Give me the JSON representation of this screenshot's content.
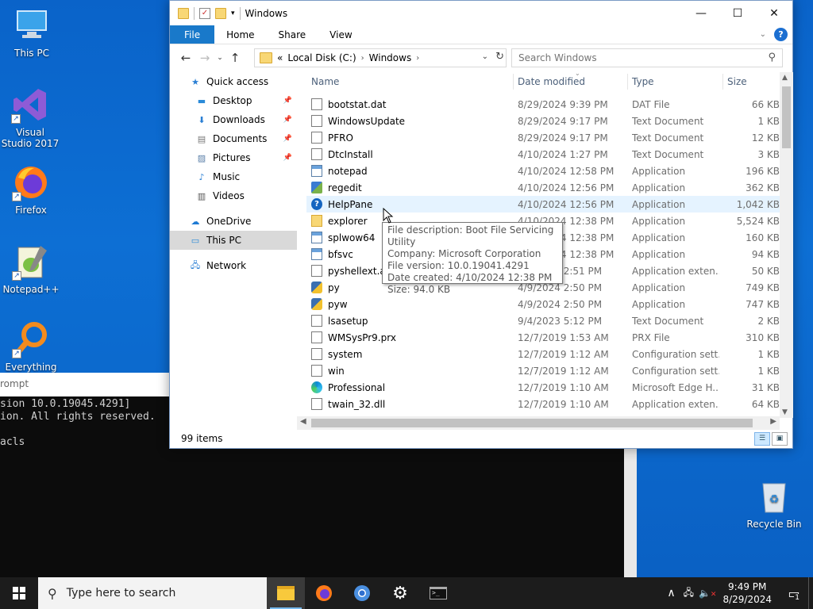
{
  "desktop": {
    "icons": [
      {
        "label": "This PC",
        "name": "this-pc-icon"
      },
      {
        "label": "Visual Studio 2017",
        "name": "visual-studio-icon"
      },
      {
        "label": "Firefox",
        "name": "firefox-icon"
      },
      {
        "label": "Notepad++",
        "name": "notepad-plus-plus-icon"
      },
      {
        "label": "Everything",
        "name": "everything-icon"
      },
      {
        "label": "Recycle Bin",
        "name": "recycle-bin-icon"
      }
    ]
  },
  "console": {
    "title_fragment": "rompt",
    "lines": [
      "sion 10.0.19045.4291]",
      "ion. All rights reserved.",
      "",
      "acls"
    ]
  },
  "explorer": {
    "title": "Windows",
    "caption": {
      "minimize": "—",
      "maximize": "☐",
      "close": "✕"
    },
    "ribbon_tabs": [
      "File",
      "Home",
      "Share",
      "View"
    ],
    "address": {
      "prefix": "«",
      "crumbs": [
        "Local Disk (C:)",
        "Windows"
      ]
    },
    "search_placeholder": "Search Windows",
    "nav": [
      {
        "label": "Quick access",
        "icon": "star-icon",
        "pinned": false,
        "selected": false,
        "indent": 1
      },
      {
        "label": "Desktop",
        "icon": "desktop-icon",
        "pinned": true,
        "selected": false,
        "indent": 2
      },
      {
        "label": "Downloads",
        "icon": "download-icon",
        "pinned": true,
        "selected": false,
        "indent": 2
      },
      {
        "label": "Documents",
        "icon": "documents-icon",
        "pinned": true,
        "selected": false,
        "indent": 2
      },
      {
        "label": "Pictures",
        "icon": "pictures-icon",
        "pinned": true,
        "selected": false,
        "indent": 2
      },
      {
        "label": "Music",
        "icon": "music-icon",
        "pinned": false,
        "selected": false,
        "indent": 2
      },
      {
        "label": "Videos",
        "icon": "videos-icon",
        "pinned": false,
        "selected": false,
        "indent": 2
      },
      {
        "label": "OneDrive",
        "icon": "onedrive-icon",
        "pinned": false,
        "selected": false,
        "indent": 1
      },
      {
        "label": "This PC",
        "icon": "computer-icon",
        "pinned": false,
        "selected": true,
        "indent": 1
      },
      {
        "label": "Network",
        "icon": "network-icon",
        "pinned": false,
        "selected": false,
        "indent": 1
      }
    ],
    "columns": {
      "name": "Name",
      "date": "Date modified",
      "type": "Type",
      "size": "Size"
    },
    "files": [
      {
        "name": "bootstat.dat",
        "date": "8/29/2024 9:39 PM",
        "type": "DAT File",
        "size": "66 KB",
        "icon": "doc"
      },
      {
        "name": "WindowsUpdate",
        "date": "8/29/2024 9:17 PM",
        "type": "Text Document",
        "size": "1 KB",
        "icon": "doc"
      },
      {
        "name": "PFRO",
        "date": "8/29/2024 9:17 PM",
        "type": "Text Document",
        "size": "12 KB",
        "icon": "doc"
      },
      {
        "name": "DtcInstall",
        "date": "4/10/2024 1:27 PM",
        "type": "Text Document",
        "size": "3 KB",
        "icon": "doc"
      },
      {
        "name": "notepad",
        "date": "4/10/2024 12:58 PM",
        "type": "Application",
        "size": "196 KB",
        "icon": "app"
      },
      {
        "name": "regedit",
        "date": "4/10/2024 12:56 PM",
        "type": "Application",
        "size": "362 KB",
        "icon": "cube"
      },
      {
        "name": "HelpPane",
        "date": "4/10/2024 12:56 PM",
        "type": "Application",
        "size": "1,042 KB",
        "icon": "help"
      },
      {
        "name": "explorer",
        "date": "4/10/2024 12:38 PM",
        "type": "Application",
        "size": "5,524 KB",
        "icon": "folder"
      },
      {
        "name": "splwow64",
        "date": "4/10/2024 12:38 PM",
        "type": "Application",
        "size": "160 KB",
        "icon": "app"
      },
      {
        "name": "bfsvc",
        "date": "4/10/2024 12:38 PM",
        "type": "Application",
        "size": "94 KB",
        "icon": "app"
      },
      {
        "name": "pyshellext.am",
        "date": "4/9/2024 2:51 PM",
        "type": "Application exten...",
        "size": "50 KB",
        "icon": "gear"
      },
      {
        "name": "py",
        "date": "4/9/2024 2:50 PM",
        "type": "Application",
        "size": "749 KB",
        "icon": "py"
      },
      {
        "name": "pyw",
        "date": "4/9/2024 2:50 PM",
        "type": "Application",
        "size": "747 KB",
        "icon": "py"
      },
      {
        "name": "lsasetup",
        "date": "9/4/2023 5:12 PM",
        "type": "Text Document",
        "size": "2 KB",
        "icon": "doc"
      },
      {
        "name": "WMSysPr9.prx",
        "date": "12/7/2019 1:53 AM",
        "type": "PRX File",
        "size": "310 KB",
        "icon": "doc"
      },
      {
        "name": "system",
        "date": "12/7/2019 1:12 AM",
        "type": "Configuration sett...",
        "size": "1 KB",
        "icon": "gear"
      },
      {
        "name": "win",
        "date": "12/7/2019 1:12 AM",
        "type": "Configuration sett...",
        "size": "1 KB",
        "icon": "gear"
      },
      {
        "name": "Professional",
        "date": "12/7/2019 1:10 AM",
        "type": "Microsoft Edge H...",
        "size": "31 KB",
        "icon": "edge"
      },
      {
        "name": "twain_32.dll",
        "date": "12/7/2019 1:10 AM",
        "type": "Application exten...",
        "size": "64 KB",
        "icon": "gear"
      }
    ],
    "hover_index": 6,
    "status": "99 items",
    "tooltip": [
      "File description: Boot File Servicing Utility",
      "Company: Microsoft Corporation",
      "File version: 10.0.19041.4291",
      "Date created: 4/10/2024 12:38 PM",
      "Size: 94.0 KB"
    ]
  },
  "taskbar": {
    "search_placeholder": "Type here to search",
    "time": "9:49 PM",
    "date": "8/29/2024",
    "notification_count": "1"
  }
}
